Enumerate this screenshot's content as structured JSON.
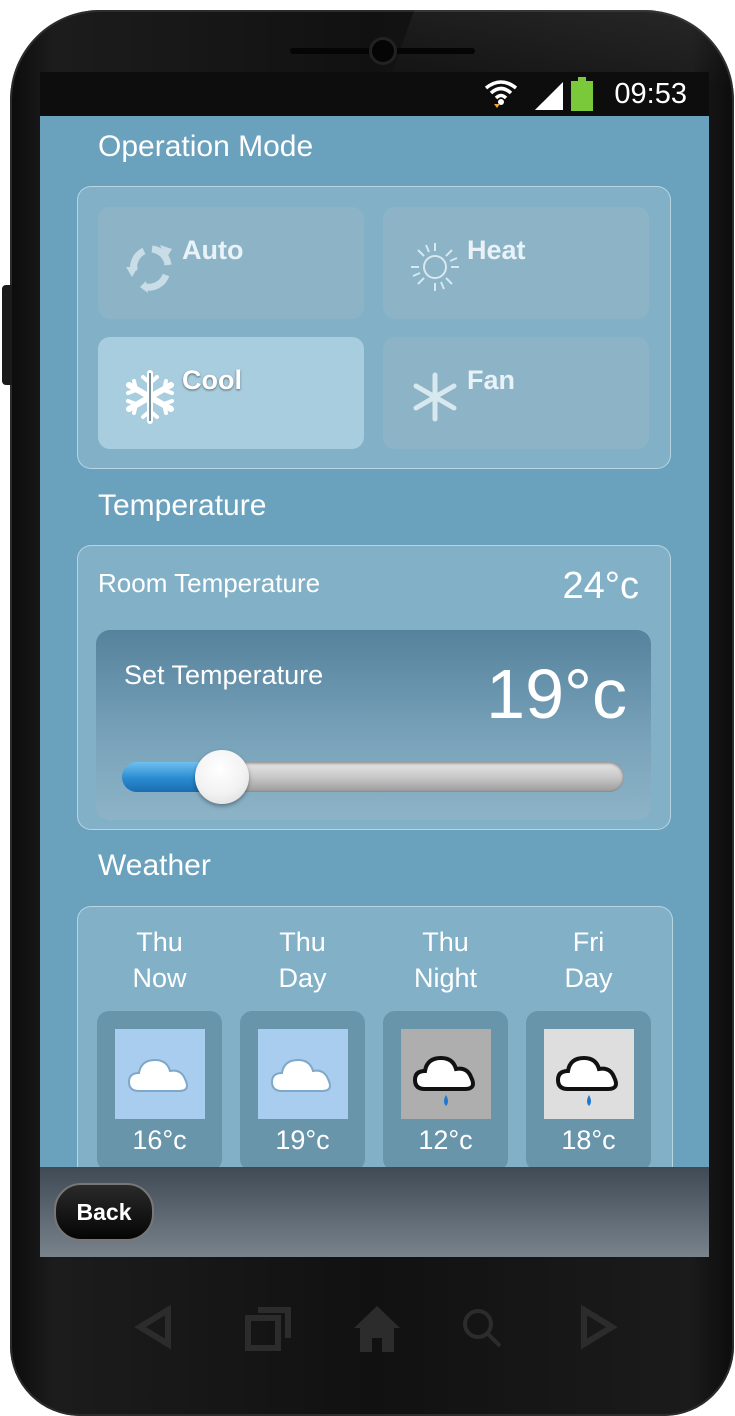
{
  "status_bar": {
    "time": "09:53",
    "icons": [
      "wifi-icon",
      "signal-icon",
      "battery-icon"
    ],
    "battery_color": "#7ac93a"
  },
  "operation_mode": {
    "title": "Operation Mode",
    "modes": [
      {
        "label": "Auto",
        "icon": "auto-cycle-icon",
        "active": false
      },
      {
        "label": "Heat",
        "icon": "sun-icon",
        "active": false
      },
      {
        "label": "Cool",
        "icon": "snowflake-icon",
        "active": true
      },
      {
        "label": "Fan",
        "icon": "fan-icon",
        "active": false
      }
    ]
  },
  "temperature": {
    "title": "Temperature",
    "room_label": "Room Temperature",
    "room_value": "24°c",
    "set_label": "Set Temperature",
    "set_value": "19°c",
    "slider_fraction": 0.2
  },
  "weather": {
    "title": "Weather",
    "forecast": [
      {
        "day": "Thu",
        "part": "Now",
        "temp": "16°c",
        "condition": "cloud-icon"
      },
      {
        "day": "Thu",
        "part": "Day",
        "temp": "19°c",
        "condition": "cloud-icon"
      },
      {
        "day": "Thu",
        "part": "Night",
        "temp": "12°c",
        "condition": "rain-cloud-icon"
      },
      {
        "day": "Fri",
        "part": "Day",
        "temp": "18°c",
        "condition": "rain-cloud-icon"
      }
    ]
  },
  "footer": {
    "back_label": "Back"
  },
  "colors": {
    "screen_bg": "#6aa1bc",
    "slider_fill": "#2a8bd1",
    "status_bar_bg": "#0d0d0d"
  },
  "nav_keys": [
    "back-arrow-icon",
    "recent-apps-icon",
    "home-icon",
    "search-icon",
    "forward-arrow-icon"
  ]
}
